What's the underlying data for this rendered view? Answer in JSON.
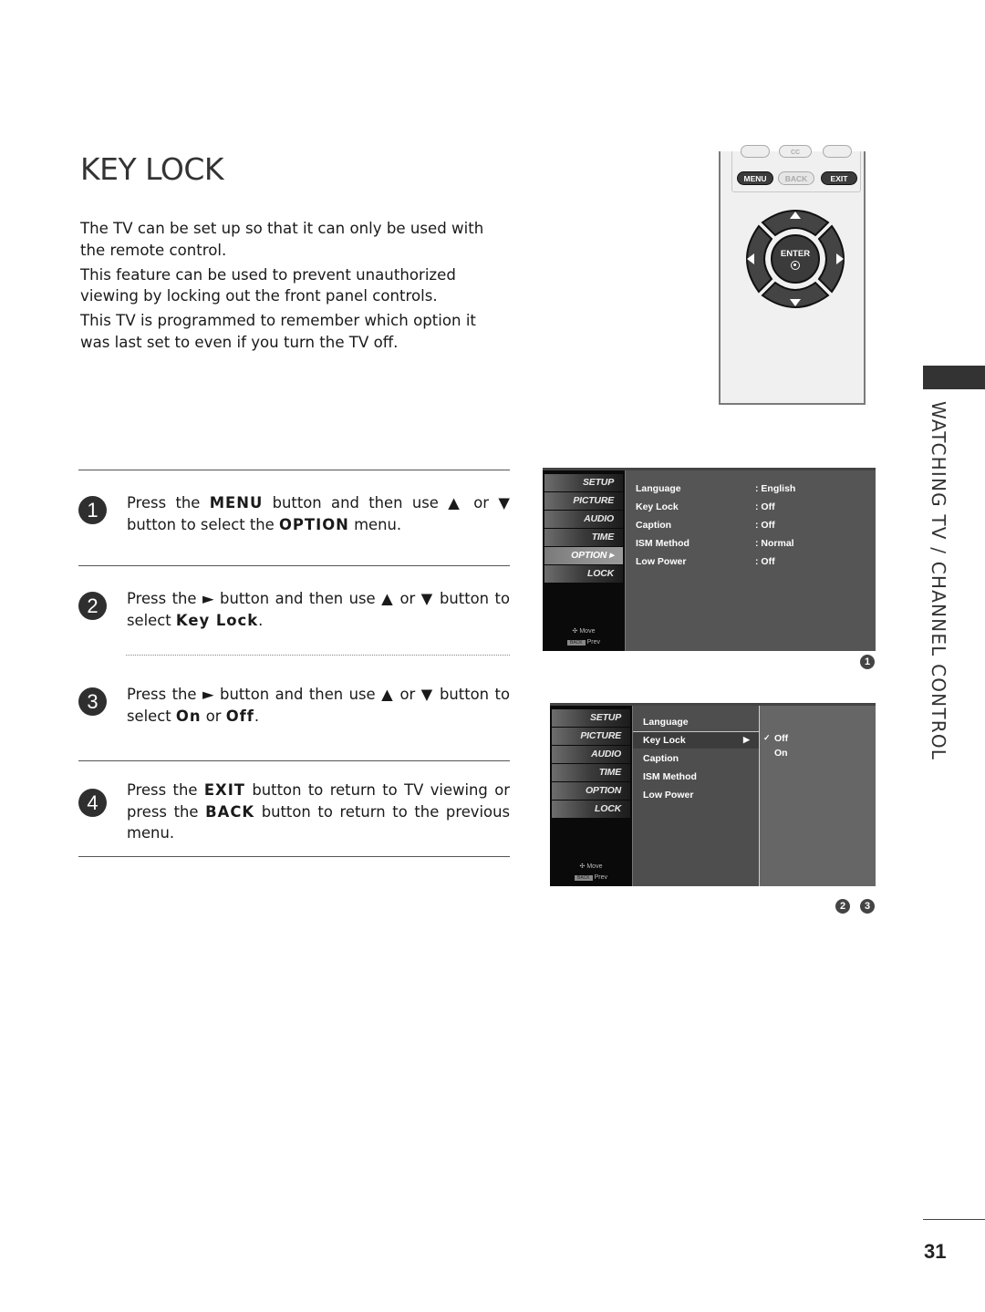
{
  "page": {
    "title": "KEY LOCK",
    "intro": [
      "The TV can be set up so that it can only be used with the remote control.",
      "This feature can be used to prevent unauthorized viewing by locking out the front panel controls.",
      "This TV is programmed to remember which option it was last set to even if you turn the TV off."
    ],
    "section_label": "WATCHING TV / CHANNEL CONTROL",
    "page_number": "31"
  },
  "remote": {
    "top_buttons": [
      "",
      "CC",
      ""
    ],
    "menu_label": "MENU",
    "back_label": "BACK",
    "exit_label": "EXIT",
    "enter_label": "ENTER",
    "icons": [
      "arrow-up-icon",
      "arrow-down-icon",
      "arrow-left-icon",
      "arrow-right-icon",
      "enter-dot-icon"
    ]
  },
  "steps": [
    {
      "number": "1",
      "parts": [
        "Press the ",
        "MENU",
        " button and then use ▲ or ▼ button to select the ",
        "OPTION",
        " menu."
      ]
    },
    {
      "number": "2",
      "parts": [
        "Press the ► button and then use ▲ or ▼ button to select ",
        "Key Lock",
        "."
      ]
    },
    {
      "number": "3",
      "parts": [
        "Press the ► button and then use ▲ or ▼ button to select ",
        "On",
        " or ",
        "Off",
        "."
      ]
    },
    {
      "number": "4",
      "parts": [
        "Press the ",
        "EXIT",
        " button to return to TV viewing or press the ",
        "BACK",
        " button to return to the previous menu."
      ]
    }
  ],
  "osd1": {
    "side_items": [
      "SETUP",
      "PICTURE",
      "AUDIO",
      "TIME",
      "OPTION",
      "LOCK"
    ],
    "active_item": "OPTION",
    "footer_move": "Move",
    "footer_back_chip": "BACK",
    "footer_prev": "Prev",
    "rows": [
      {
        "label": "Language",
        "value": ": English"
      },
      {
        "label": "Key Lock",
        "value": ": Off"
      },
      {
        "label": "Caption",
        "value": ": Off"
      },
      {
        "label": "ISM Method",
        "value": ": Normal"
      },
      {
        "label": "Low Power",
        "value": ": Off"
      }
    ],
    "step_badges": [
      "1"
    ]
  },
  "osd2": {
    "side_items": [
      "SETUP",
      "PICTURE",
      "AUDIO",
      "TIME",
      "OPTION",
      "LOCK"
    ],
    "footer_move": "Move",
    "footer_back_chip": "BACK",
    "footer_prev": "Prev",
    "rows": [
      "Language",
      "Key Lock",
      "Caption",
      "ISM Method",
      "Low Power"
    ],
    "selected_row": "Key Lock",
    "submenu_arrow": "▶",
    "options": [
      {
        "label": "Off",
        "checked": true,
        "check_glyph": "✓"
      },
      {
        "label": "On",
        "checked": false,
        "check_glyph": ""
      }
    ],
    "step_badges": [
      "2",
      "3"
    ]
  }
}
